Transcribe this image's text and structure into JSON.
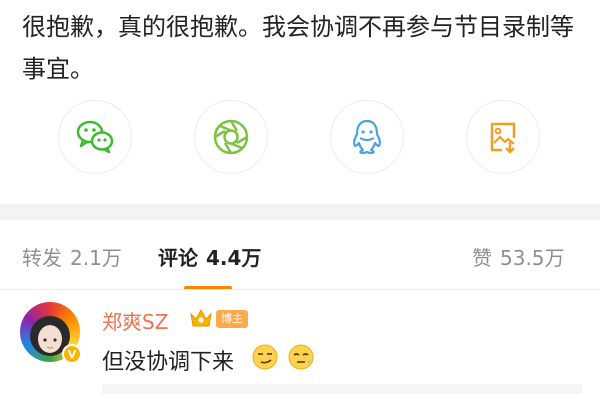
{
  "post": {
    "text": "很抱歉，真的很抱歉。我会协调不再参与节目录制等事宜。"
  },
  "share": {
    "items": [
      {
        "icon": "wechat-icon"
      },
      {
        "icon": "moments-icon"
      },
      {
        "icon": "qq-icon"
      },
      {
        "icon": "save-image-icon"
      }
    ]
  },
  "tabs": {
    "repost_label": "转发",
    "repost_count": "2.1万",
    "comment_label": "评论",
    "comment_count": "4.4万",
    "like_label": "赞",
    "like_count": "53.5万"
  },
  "comment": {
    "username": "郑爽SZ",
    "badge": "博主",
    "verified_mark": "V",
    "text": "但没协调下来"
  },
  "colors": {
    "accent": "#ff8200",
    "username": "#eb7350",
    "muted": "#8f8f8f",
    "section_gap": "#f3f3f3"
  }
}
